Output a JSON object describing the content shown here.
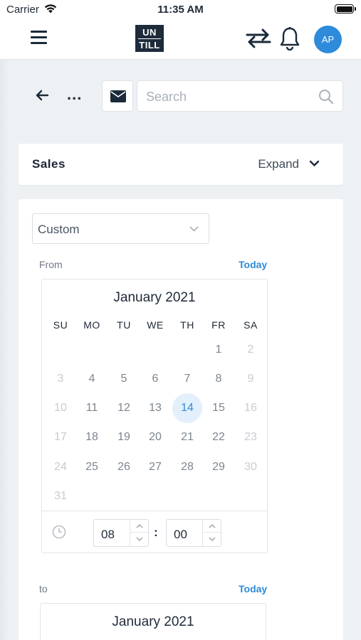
{
  "status": {
    "carrier": "Carrier",
    "time": "11:35 AM"
  },
  "header": {
    "logo_top": "UN",
    "logo_bottom": "TILL",
    "avatar_initials": "AP"
  },
  "toolbar": {
    "more": "...",
    "search_placeholder": "Search"
  },
  "sales": {
    "title": "Sales",
    "expand_label": "Expand"
  },
  "filter": {
    "period_value": "Custom",
    "from_label": "From",
    "from_today": "Today",
    "to_label": "to",
    "to_today": "Today"
  },
  "calendar_from": {
    "month": "January 2021",
    "weekdays": [
      "SU",
      "MO",
      "TU",
      "WE",
      "TH",
      "FR",
      "SA"
    ],
    "weeks": [
      [
        "",
        "",
        "",
        "",
        "",
        "1",
        "2"
      ],
      [
        "3",
        "4",
        "5",
        "6",
        "7",
        "8",
        "9"
      ],
      [
        "10",
        "11",
        "12",
        "13",
        "14",
        "15",
        "16"
      ],
      [
        "17",
        "18",
        "19",
        "20",
        "21",
        "22",
        "23"
      ],
      [
        "24",
        "25",
        "26",
        "27",
        "28",
        "29",
        "30"
      ],
      [
        "31",
        "",
        "",
        "",
        "",
        "",
        ""
      ]
    ],
    "selected": "14",
    "hour": "08",
    "minute": "00",
    "separator": ":"
  },
  "calendar_to": {
    "month": "January 2021"
  },
  "colors": {
    "accent": "#2e8bd9",
    "selected_bg": "#e3f0fb",
    "nav": "#1d2b3b"
  }
}
